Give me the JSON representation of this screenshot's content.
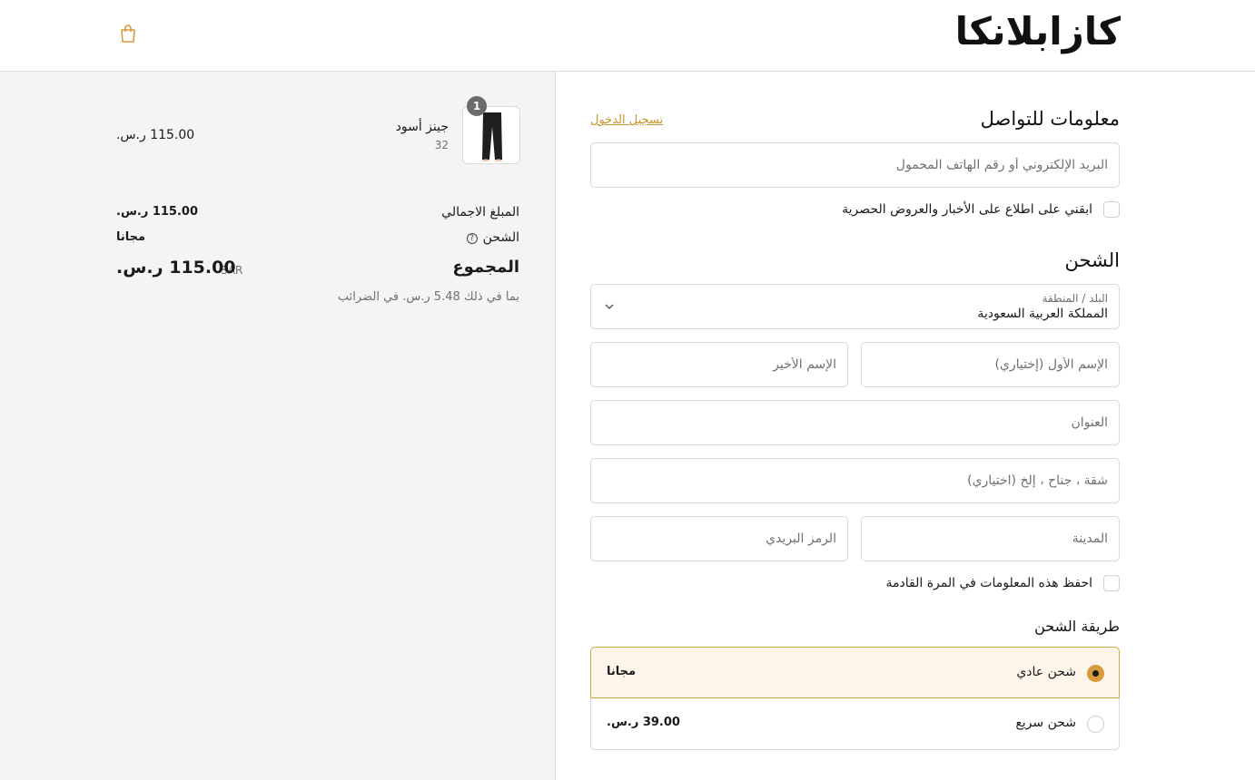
{
  "header": {
    "logo": "كازابلانكا",
    "bag_icon": "shopping-bag-icon",
    "accent": "#c9952d"
  },
  "summary": {
    "product": {
      "name": "جينز أسود",
      "variant": "32",
      "quantity": "1",
      "price": "115.00 ر.س."
    },
    "subtotal_label": "المبلغ الاجمالي",
    "subtotal_value": "115.00 ر.س.",
    "shipping_label": "الشحن",
    "shipping_help_icon": "question-circle-icon",
    "shipping_value": "مجانا",
    "total_label": "المجموع",
    "currency_code": "SAR",
    "total_value": "115.00 ر.س.",
    "tax_note": "بما في ذلك 5.48 ر.س. في الضرائب"
  },
  "contact": {
    "title": "معلومات للتواصل",
    "login_link": "تسجيل الدخول",
    "email_placeholder": "البريد الإلكتروني أو رقم الهاتف المحمول",
    "newsletter_label": "ابقني على اطلاع على الأخبار والعروض الحصرية"
  },
  "shipping": {
    "title": "الشحن",
    "country_label": "البلد / المنطقة",
    "country_value": "المملكة العربية السعودية",
    "first_name_placeholder": "الإسم الأول (إختياري)",
    "last_name_placeholder": "الإسم الأخير",
    "address_placeholder": "العنوان",
    "apartment_placeholder": "شقة ، جناح ، إلخ (اختياري)",
    "city_placeholder": "المدينة",
    "postal_placeholder": "الرمز البريدي",
    "save_info_label": "احفظ هذه المعلومات في المرة القادمة"
  },
  "shipping_method": {
    "title": "طريقة الشحن",
    "options": [
      {
        "name": "شحن عادي",
        "price": "مجانا",
        "selected": true
      },
      {
        "name": "شحن سريع",
        "price": "39.00 ر.س.",
        "selected": false
      }
    ],
    "selected_bg": "#fdf5ea",
    "selected_border": "#d9a845"
  }
}
